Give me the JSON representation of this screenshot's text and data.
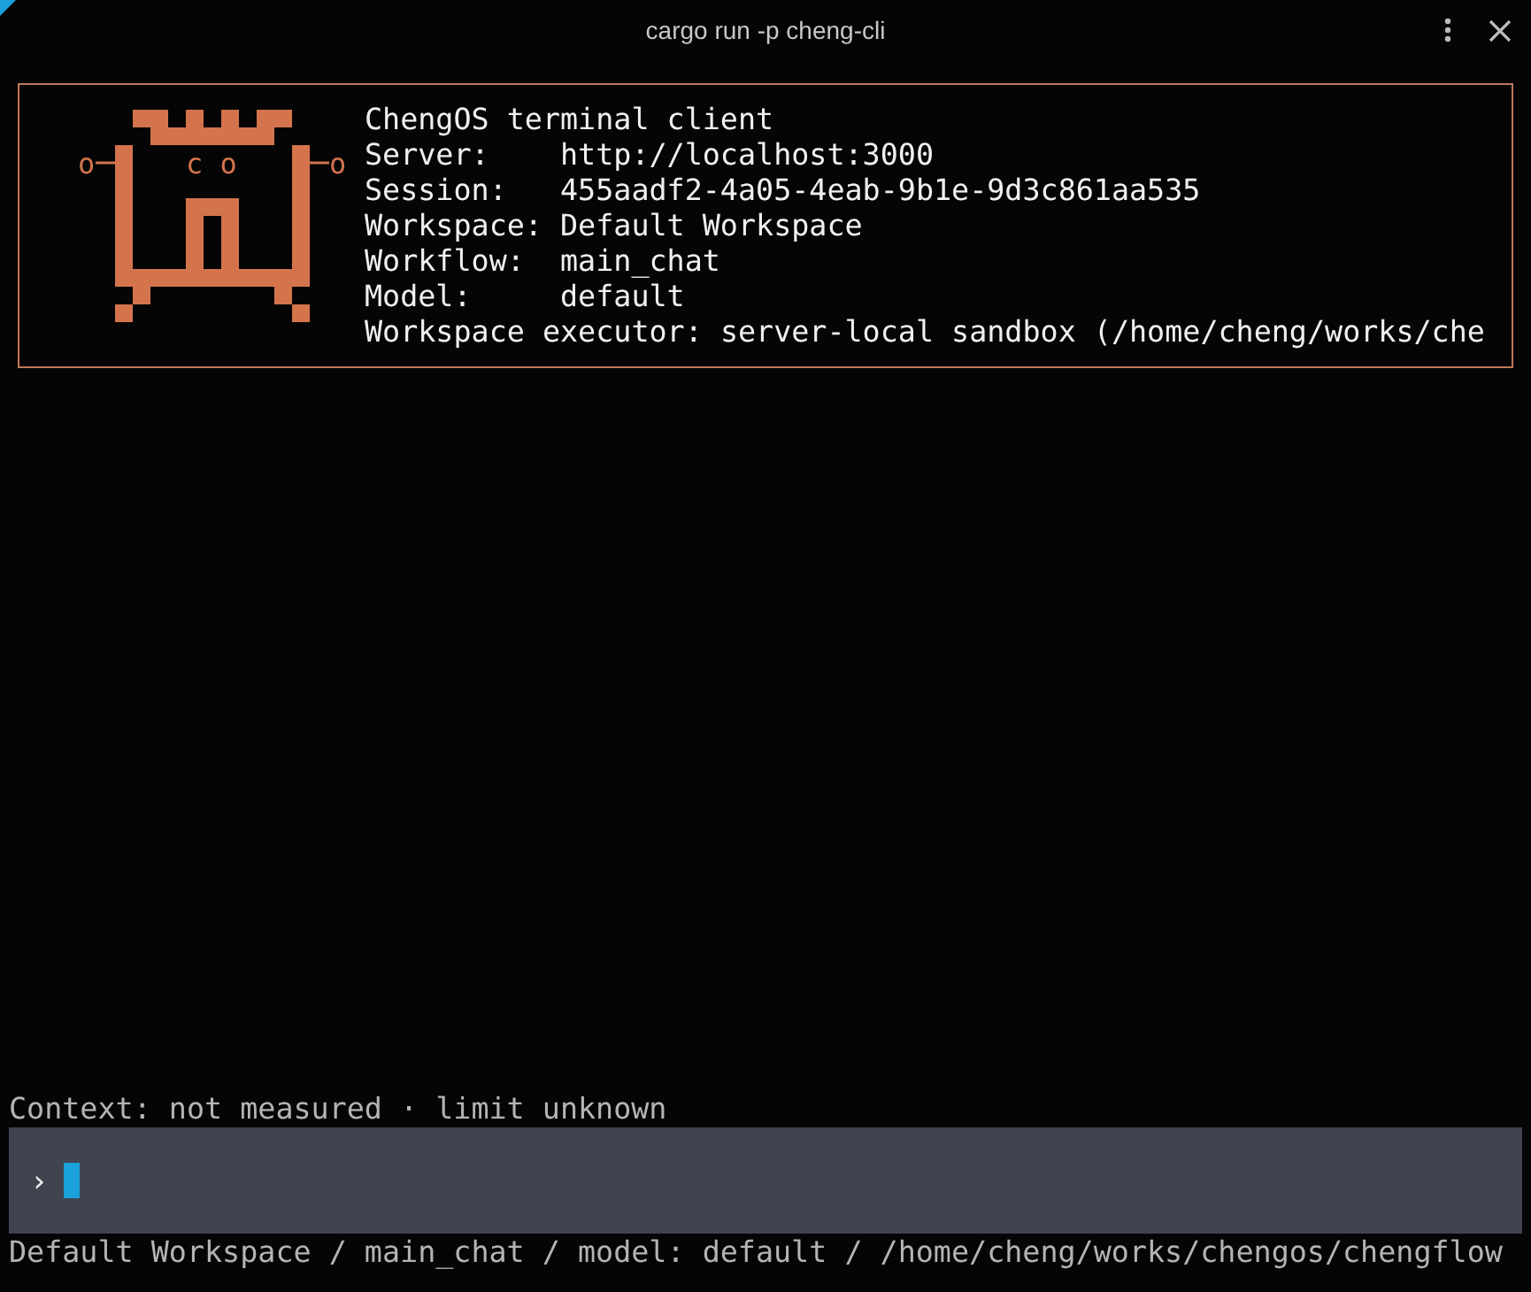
{
  "window": {
    "title": "cargo run -p cheng-cli"
  },
  "logo": {
    "left_glyph": "o",
    "eyes": "c o",
    "right_glyph": "o"
  },
  "banner": {
    "heading": "ChengOS terminal client",
    "lines": [
      {
        "label": "Server:    ",
        "value": "http://localhost:3000"
      },
      {
        "label": "Session:   ",
        "value": "455aadf2-4a05-4eab-9b1e-9d3c861aa535"
      },
      {
        "label": "Workspace: ",
        "value": "Default Workspace"
      },
      {
        "label": "Workflow:  ",
        "value": "main_chat"
      },
      {
        "label": "Model:     ",
        "value": "default"
      },
      {
        "label": "Workspace executor: ",
        "value": "server-local sandbox (/home/cheng/works/che"
      }
    ]
  },
  "context": "Context: not measured · limit unknown",
  "prompt": {
    "symbol": "›"
  },
  "status_bar": "Default Workspace / main_chat / model: default / /home/cheng/works/chengos/chengflow"
}
